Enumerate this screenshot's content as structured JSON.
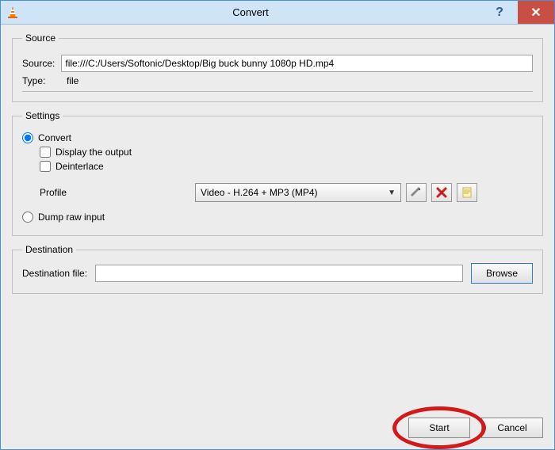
{
  "titlebar": {
    "title": "Convert"
  },
  "source": {
    "legend": "Source",
    "source_label": "Source:",
    "source_value": "file:///C:/Users/Softonic/Desktop/Big buck bunny 1080p HD.mp4",
    "type_label": "Type:",
    "type_value": "file"
  },
  "settings": {
    "legend": "Settings",
    "convert_label": "Convert",
    "display_output_label": "Display the output",
    "deinterlace_label": "Deinterlace",
    "profile_label": "Profile",
    "profile_selected": "Video - H.264 + MP3 (MP4)",
    "dump_label": "Dump raw input"
  },
  "destination": {
    "legend": "Destination",
    "dest_label": "Destination file:",
    "dest_value": "",
    "browse_label": "Browse"
  },
  "footer": {
    "start_label": "Start",
    "cancel_label": "Cancel"
  }
}
